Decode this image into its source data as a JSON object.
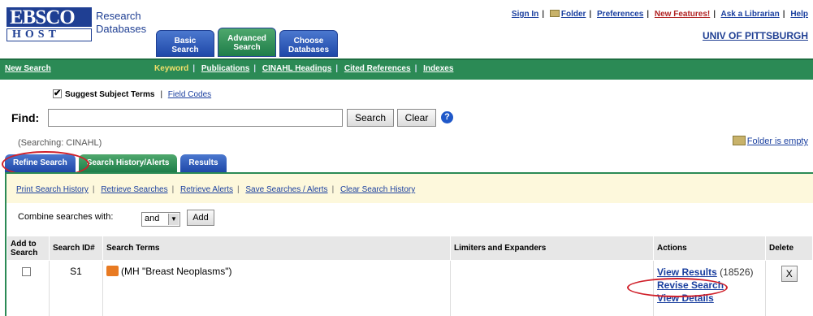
{
  "logo": {
    "top": "EBSCO",
    "bottom": "HOST"
  },
  "brand": {
    "line1": "Research",
    "line2": "Databases"
  },
  "top_tabs": [
    {
      "line1": "Basic",
      "line2": "Search",
      "color": "blue"
    },
    {
      "line1": "Advanced",
      "line2": "Search",
      "color": "green"
    },
    {
      "line1": "Choose",
      "line2": "Databases",
      "color": "blue"
    }
  ],
  "toplinks": {
    "sign_in": "Sign In",
    "folder": "Folder",
    "preferences": "Preferences",
    "new_features": "New Features!",
    "ask": "Ask a Librarian",
    "help": "Help"
  },
  "institution": "UNIV OF PITTSBURGH",
  "navbar": {
    "new_search": "New Search",
    "links": [
      "Keyword",
      "Publications",
      "CINAHL Headings",
      "Cited References",
      "Indexes"
    ]
  },
  "suggest": {
    "label": "Suggest Subject Terms",
    "field_codes": "Field Codes"
  },
  "find": {
    "label": "Find:",
    "value": "",
    "search_btn": "Search",
    "clear_btn": "Clear",
    "help": "?"
  },
  "searching": "(Searching: CINAHL)",
  "folder_empty": "Folder is empty",
  "lower_tabs": [
    "Refine Search",
    "Search History/Alerts",
    "Results"
  ],
  "history_links": [
    "Print Search History",
    "Retrieve Searches",
    "Retrieve Alerts",
    "Save Searches / Alerts",
    "Clear Search History"
  ],
  "combine": {
    "label": "Combine searches with:",
    "selected": "and",
    "add": "Add"
  },
  "table": {
    "headers": [
      "Add to Search",
      "Search ID#",
      "Search Terms",
      "Limiters and Expanders",
      "Actions",
      "Delete"
    ],
    "rows": [
      {
        "id": "S1",
        "terms": "(MH \"Breast Neoplasms\")",
        "limiters": "",
        "view_results": "View Results",
        "count": "(18526)",
        "revise": "Revise Search",
        "details": "View Details",
        "delete": "X"
      }
    ]
  },
  "colors": {
    "brand_blue": "#1f3f93",
    "nav_green": "#2b8a55",
    "highlight_red": "#d0202a"
  }
}
